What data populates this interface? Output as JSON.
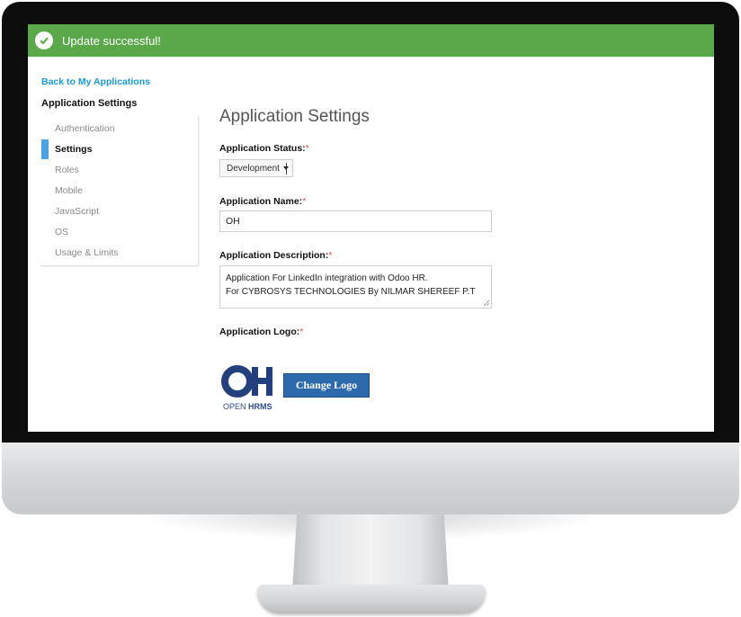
{
  "alert": {
    "message": "Update successful!",
    "color": "#5aa84a"
  },
  "sidebar": {
    "back_link": "Back to My Applications",
    "title": "Application Settings",
    "items": [
      {
        "label": "Authentication",
        "active": false
      },
      {
        "label": "Settings",
        "active": true
      },
      {
        "label": "Roles",
        "active": false
      },
      {
        "label": "Mobile",
        "active": false
      },
      {
        "label": "JavaScript",
        "active": false
      },
      {
        "label": "OS",
        "active": false
      },
      {
        "label": "Usage & Limits",
        "active": false
      }
    ]
  },
  "main": {
    "title": "Application Settings",
    "status": {
      "label": "Application Status:",
      "required_mark": "*",
      "value": "Development"
    },
    "name": {
      "label": "Application Name:",
      "required_mark": "*",
      "value": "OH"
    },
    "description": {
      "label": "Application Description:",
      "required_mark": "*",
      "line1": "Application For LinkedIn integration with Odoo HR.",
      "line2": "For CYBROSYS TECHNOLOGIES By NILMAR SHEREEF P.T"
    },
    "logo": {
      "label": "Application Logo:",
      "required_mark": "*",
      "brand_open": "OPEN",
      "brand_hrms": "HRMS",
      "button_label": "Change Logo"
    }
  },
  "colors": {
    "accent": "#4da3e0",
    "link": "#1c98d3",
    "button": "#2d6aab"
  }
}
